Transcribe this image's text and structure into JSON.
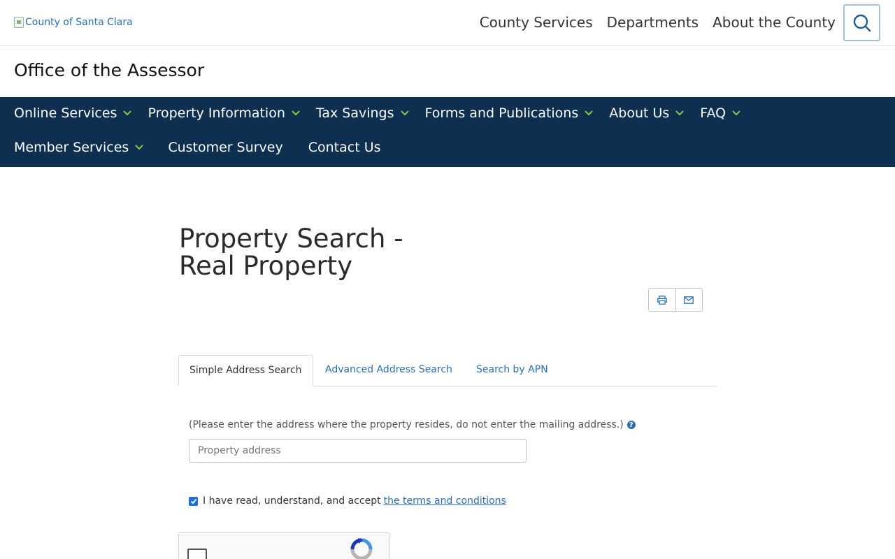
{
  "header": {
    "logo_alt": "County of Santa Clara",
    "top_links": [
      "County Services",
      "Departments",
      "About the County"
    ]
  },
  "office_title": "Office of the Assessor",
  "main_nav": {
    "row1": [
      "Online Services",
      "Property Information",
      "Tax Savings",
      "Forms and Publications",
      "About Us",
      "FAQ"
    ],
    "row2_dropdown": "Member Services",
    "row2_links": [
      "Customer Survey",
      "Contact Us"
    ]
  },
  "page": {
    "title_line1": "Property Search -",
    "title_line2": "Real Property"
  },
  "tabs": [
    "Simple Address Search",
    "Advanced Address Search",
    "Search by APN"
  ],
  "form": {
    "hint": "(Please enter the address where the property resides, do not enter the mailing address.)",
    "address_placeholder": "Property address",
    "address_value": "",
    "terms_prefix": "I have read, understand, and accept",
    "terms_link": "the terms and conditions",
    "terms_checked": true
  },
  "colors": {
    "nav_bg": "#0f2f50",
    "chevron": "#8cc63f",
    "link": "#2a6fb0"
  }
}
